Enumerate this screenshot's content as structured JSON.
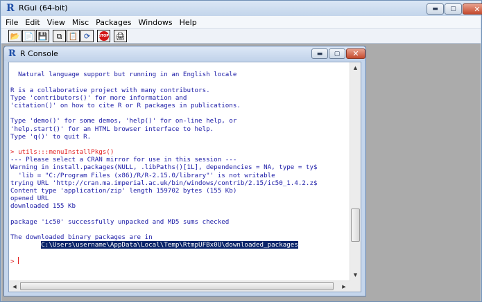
{
  "app": {
    "title": "RGui (64-bit)",
    "icon": "R"
  },
  "menu": [
    "File",
    "Edit",
    "View",
    "Misc",
    "Packages",
    "Windows",
    "Help"
  ],
  "toolbar": {
    "icons": [
      "open-script-icon",
      "load-workspace-icon",
      "save-workspace-icon",
      "copy-icon",
      "paste-icon",
      "copy-paste-icon",
      "stop-icon",
      "print-icon"
    ],
    "stop_label": "STOP"
  },
  "window_controls": {
    "minimize": "▬",
    "maximize": "▢",
    "close": "✕"
  },
  "console": {
    "title": "R Console",
    "icon": "R",
    "lines": [
      {
        "text": "",
        "style": "normal"
      },
      {
        "text": "  Natural language support but running in an English locale",
        "style": "normal"
      },
      {
        "text": "",
        "style": "normal"
      },
      {
        "text": "R is a collaborative project with many contributors.",
        "style": "normal"
      },
      {
        "text": "Type 'contributors()' for more information and",
        "style": "normal"
      },
      {
        "text": "'citation()' on how to cite R or R packages in publications.",
        "style": "normal"
      },
      {
        "text": "",
        "style": "normal"
      },
      {
        "text": "Type 'demo()' for some demos, 'help()' for on-line help, or",
        "style": "normal"
      },
      {
        "text": "'help.start()' for an HTML browser interface to help.",
        "style": "normal"
      },
      {
        "text": "Type 'q()' to quit R.",
        "style": "normal"
      },
      {
        "text": "",
        "style": "normal"
      },
      {
        "text": "> utils:::menuInstallPkgs()",
        "style": "red"
      },
      {
        "text": "--- Please select a CRAN mirror for use in this session ---",
        "style": "normal"
      },
      {
        "text": "Warning in install.packages(NULL, .libPaths()[1L], dependencies = NA, type = ty$",
        "style": "normal"
      },
      {
        "text": "  'lib = \"C:/Program Files (x86)/R/R-2.15.0/library\"' is not writable",
        "style": "normal"
      },
      {
        "text": "trying URL 'http://cran.ma.imperial.ac.uk/bin/windows/contrib/2.15/ic50_1.4.2.z$",
        "style": "normal"
      },
      {
        "text": "Content type 'application/zip' length 159702 bytes (155 Kb)",
        "style": "normal"
      },
      {
        "text": "opened URL",
        "style": "normal"
      },
      {
        "text": "downloaded 155 Kb",
        "style": "normal"
      },
      {
        "text": "",
        "style": "normal"
      },
      {
        "text": "package 'ic50' successfully unpacked and MD5 sums checked",
        "style": "normal"
      },
      {
        "text": "",
        "style": "normal"
      },
      {
        "text": "The downloaded binary packages are in",
        "style": "normal"
      }
    ],
    "highlight_indent": "        ",
    "highlight_path": "C:\\Users\\username\\AppData\\Local\\Temp\\RtmpUFBx0U\\downloaded_packages",
    "prompt": "> "
  },
  "scroll": {
    "vertical_position": 0.83,
    "horizontal_position": 0.0
  }
}
